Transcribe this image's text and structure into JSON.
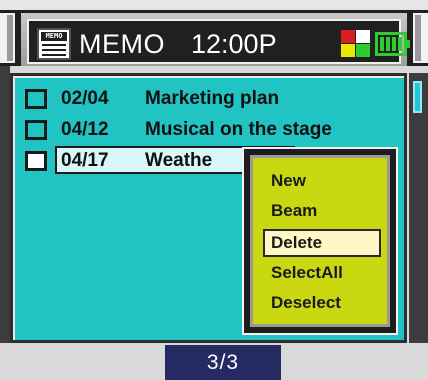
{
  "header": {
    "app_icon": "memo-icon",
    "app_icon_label": "MEMO",
    "title": "MEMO",
    "clock": "12:00P",
    "status_icons": [
      "quad-color-icon",
      "battery-icon"
    ],
    "colors": {
      "title_bg": "#202020",
      "quad": [
        "#d61f1f",
        "#e8e800",
        "#2ecc2e",
        "#ffffff"
      ],
      "battery": "#2ecc2e"
    }
  },
  "memos": [
    {
      "date": "02/04",
      "title": "Marketing plan",
      "selected": false
    },
    {
      "date": "04/12",
      "title": "Musical on the stage",
      "selected": false
    },
    {
      "date": "04/17",
      "title": "Weathe",
      "selected": true
    }
  ],
  "menu": {
    "items": [
      {
        "label": "New",
        "active": false
      },
      {
        "label": "Beam",
        "active": false
      },
      {
        "label": "Delete",
        "active": true
      },
      {
        "label": "SelectAll",
        "active": false
      },
      {
        "label": "Deselect",
        "active": false
      }
    ]
  },
  "footer": {
    "page": "3/3"
  },
  "colors": {
    "panel": "#22c3c3",
    "menu_bg": "#c9d810",
    "menu_active": "#fff7c6",
    "page_indicator": "#252a63"
  }
}
